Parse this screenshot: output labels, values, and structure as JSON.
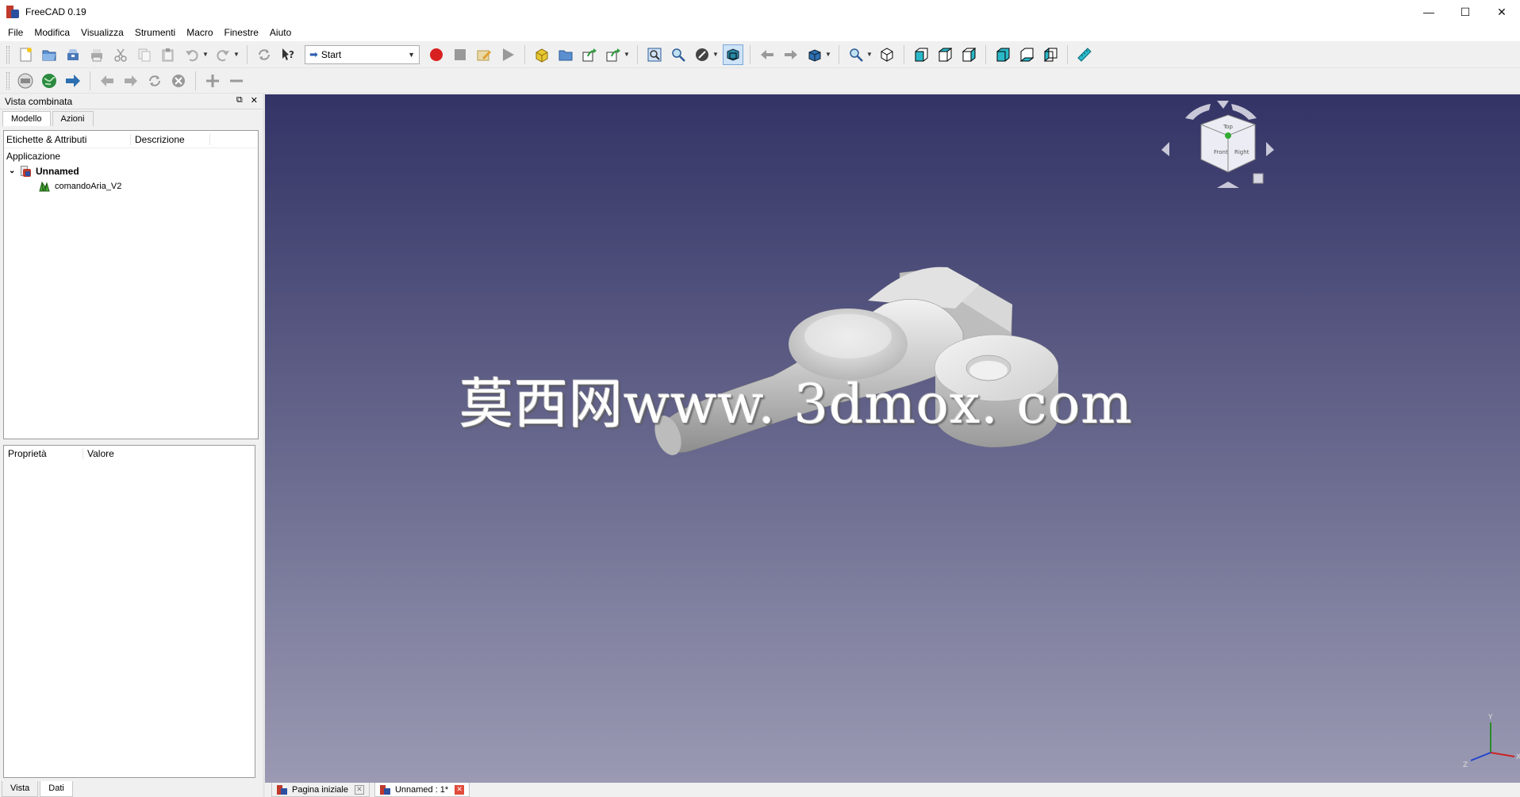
{
  "window": {
    "title": "FreeCAD 0.19",
    "min": "—",
    "max": "☐",
    "close": "✕"
  },
  "menu": [
    "File",
    "Modifica",
    "Visualizza",
    "Strumenti",
    "Macro",
    "Finestre",
    "Aiuto"
  ],
  "workbench": {
    "selected": "Start"
  },
  "combo_view": {
    "title": "Vista combinata",
    "tabs": [
      "Modello",
      "Azioni"
    ],
    "tree": {
      "col_labels": "Etichette & Attributi",
      "col_description": "Descrizione",
      "application": "Applicazione",
      "document": "Unnamed",
      "object": "comandoAria_V2"
    },
    "properties": {
      "col_property": "Proprietà",
      "col_value": "Valore"
    },
    "bottom_tabs": [
      "Vista",
      "Dati"
    ]
  },
  "viewport": {
    "watermark": "莫西网www. 3dmox. com",
    "bg_top": "#333366",
    "bg_bottom": "#9a9ab3",
    "axis_labels": {
      "x": "X",
      "y": "Y",
      "z": "Z"
    }
  },
  "doc_tabs": [
    {
      "label": "Pagina iniziale",
      "active": false
    },
    {
      "label": "Unnamed : 1*",
      "active": true
    }
  ],
  "icons": {
    "toolbar1": [
      "new-document",
      "open",
      "save",
      "print",
      "cut",
      "copy",
      "paste",
      "undo",
      "redo",
      "refresh",
      "whats-this",
      "macro-record",
      "macro-stop",
      "macro-edit",
      "macro-run",
      "part",
      "group",
      "link",
      "link-actions",
      "fit-all",
      "fit-selection",
      "draw-style",
      "bounding-box",
      "back",
      "forward",
      "std-view-menu",
      "measure-zoom",
      "isometric",
      "front",
      "top",
      "right",
      "rear",
      "bottom",
      "left",
      "measure"
    ],
    "toolbar2": [
      "web-home",
      "web-open",
      "web-back",
      "web-forward",
      "web-refresh",
      "web-stop",
      "zoom-in",
      "zoom-out"
    ]
  }
}
